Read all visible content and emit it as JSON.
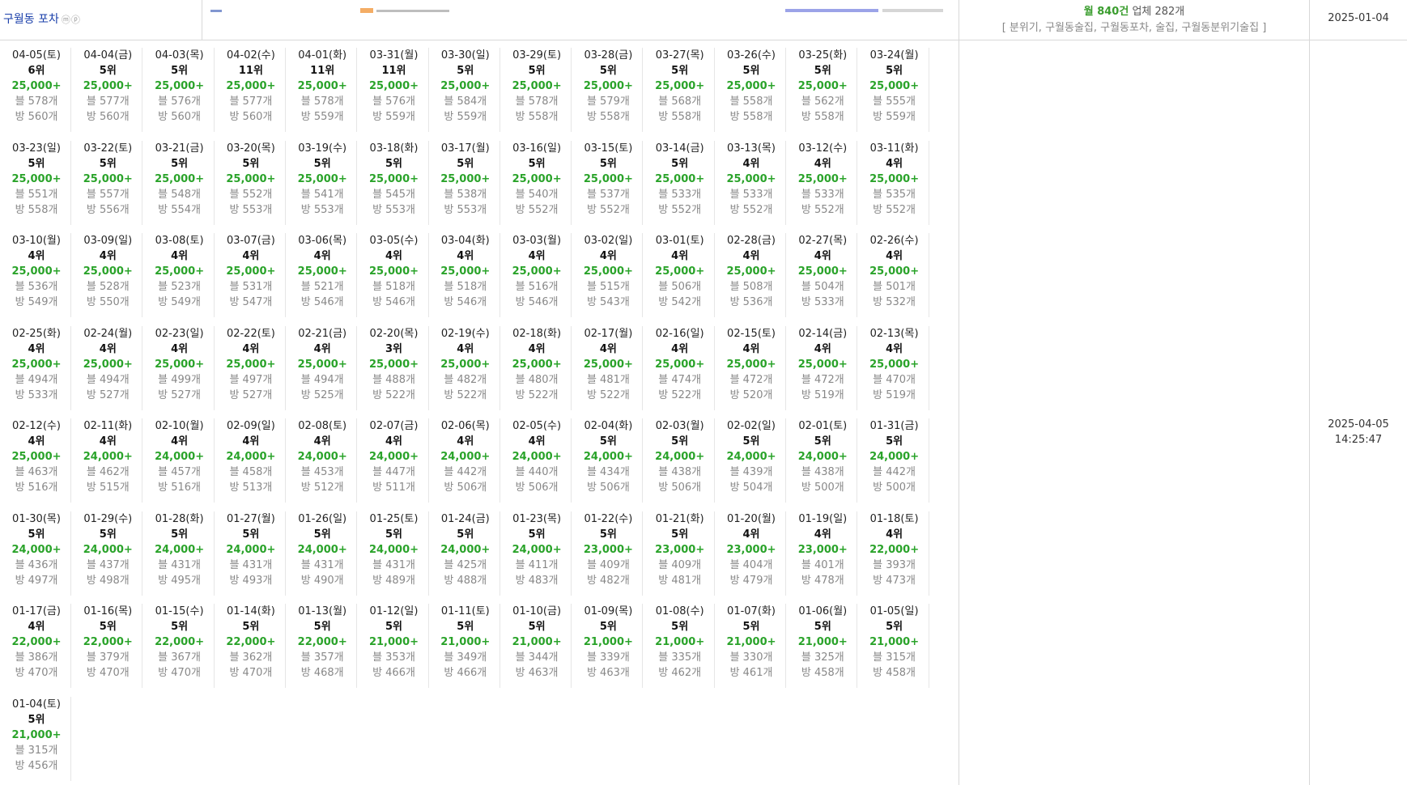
{
  "header": {
    "shop_name": "구월동 포차",
    "shop_badge": "ⓜⓟ",
    "summary_prefix": "월 ",
    "summary_count": "840건",
    "summary_suffix": " 업체 282개",
    "keywords": "[ 분위기, 구월동술집, 구월동포차, 술집, 구월동분위기술집 ]",
    "start_date": "2025-01-04"
  },
  "updated_date": "2025-04-05",
  "updated_time": "14:25:47",
  "colors": {
    "price": "#2aa32a",
    "title": "#1a3faa",
    "muted": "#888888",
    "accent": "#3a9d2e"
  },
  "entries": [
    {
      "date": "04-05(토)",
      "rank": "6위",
      "price": "25,000+",
      "blog": "블 578개",
      "bang": "방 560개"
    },
    {
      "date": "04-04(금)",
      "rank": "5위",
      "price": "25,000+",
      "blog": "블 577개",
      "bang": "방 560개"
    },
    {
      "date": "04-03(목)",
      "rank": "5위",
      "price": "25,000+",
      "blog": "블 576개",
      "bang": "방 560개"
    },
    {
      "date": "04-02(수)",
      "rank": "11위",
      "price": "25,000+",
      "blog": "블 577개",
      "bang": "방 560개"
    },
    {
      "date": "04-01(화)",
      "rank": "11위",
      "price": "25,000+",
      "blog": "블 578개",
      "bang": "방 559개"
    },
    {
      "date": "03-31(월)",
      "rank": "11위",
      "price": "25,000+",
      "blog": "블 576개",
      "bang": "방 559개"
    },
    {
      "date": "03-30(일)",
      "rank": "5위",
      "price": "25,000+",
      "blog": "블 584개",
      "bang": "방 559개"
    },
    {
      "date": "03-29(토)",
      "rank": "5위",
      "price": "25,000+",
      "blog": "블 578개",
      "bang": "방 558개"
    },
    {
      "date": "03-28(금)",
      "rank": "5위",
      "price": "25,000+",
      "blog": "블 579개",
      "bang": "방 558개"
    },
    {
      "date": "03-27(목)",
      "rank": "5위",
      "price": "25,000+",
      "blog": "블 568개",
      "bang": "방 558개"
    },
    {
      "date": "03-26(수)",
      "rank": "5위",
      "price": "25,000+",
      "blog": "블 558개",
      "bang": "방 558개"
    },
    {
      "date": "03-25(화)",
      "rank": "5위",
      "price": "25,000+",
      "blog": "블 562개",
      "bang": "방 558개"
    },
    {
      "date": "03-24(월)",
      "rank": "5위",
      "price": "25,000+",
      "blog": "블 555개",
      "bang": "방 559개"
    },
    {
      "date": "03-23(일)",
      "rank": "5위",
      "price": "25,000+",
      "blog": "블 551개",
      "bang": "방 558개"
    },
    {
      "date": "03-22(토)",
      "rank": "5위",
      "price": "25,000+",
      "blog": "블 557개",
      "bang": "방 556개"
    },
    {
      "date": "03-21(금)",
      "rank": "5위",
      "price": "25,000+",
      "blog": "블 548개",
      "bang": "방 554개"
    },
    {
      "date": "03-20(목)",
      "rank": "5위",
      "price": "25,000+",
      "blog": "블 552개",
      "bang": "방 553개"
    },
    {
      "date": "03-19(수)",
      "rank": "5위",
      "price": "25,000+",
      "blog": "블 541개",
      "bang": "방 553개"
    },
    {
      "date": "03-18(화)",
      "rank": "5위",
      "price": "25,000+",
      "blog": "블 545개",
      "bang": "방 553개"
    },
    {
      "date": "03-17(월)",
      "rank": "5위",
      "price": "25,000+",
      "blog": "블 538개",
      "bang": "방 553개"
    },
    {
      "date": "03-16(일)",
      "rank": "5위",
      "price": "25,000+",
      "blog": "블 540개",
      "bang": "방 552개"
    },
    {
      "date": "03-15(토)",
      "rank": "5위",
      "price": "25,000+",
      "blog": "블 537개",
      "bang": "방 552개"
    },
    {
      "date": "03-14(금)",
      "rank": "5위",
      "price": "25,000+",
      "blog": "블 533개",
      "bang": "방 552개"
    },
    {
      "date": "03-13(목)",
      "rank": "4위",
      "price": "25,000+",
      "blog": "블 533개",
      "bang": "방 552개"
    },
    {
      "date": "03-12(수)",
      "rank": "4위",
      "price": "25,000+",
      "blog": "블 533개",
      "bang": "방 552개"
    },
    {
      "date": "03-11(화)",
      "rank": "4위",
      "price": "25,000+",
      "blog": "블 535개",
      "bang": "방 552개"
    },
    {
      "date": "03-10(월)",
      "rank": "4위",
      "price": "25,000+",
      "blog": "블 536개",
      "bang": "방 549개"
    },
    {
      "date": "03-09(일)",
      "rank": "4위",
      "price": "25,000+",
      "blog": "블 528개",
      "bang": "방 550개"
    },
    {
      "date": "03-08(토)",
      "rank": "4위",
      "price": "25,000+",
      "blog": "블 523개",
      "bang": "방 549개"
    },
    {
      "date": "03-07(금)",
      "rank": "4위",
      "price": "25,000+",
      "blog": "블 531개",
      "bang": "방 547개"
    },
    {
      "date": "03-06(목)",
      "rank": "4위",
      "price": "25,000+",
      "blog": "블 521개",
      "bang": "방 546개"
    },
    {
      "date": "03-05(수)",
      "rank": "4위",
      "price": "25,000+",
      "blog": "블 518개",
      "bang": "방 546개"
    },
    {
      "date": "03-04(화)",
      "rank": "4위",
      "price": "25,000+",
      "blog": "블 518개",
      "bang": "방 546개"
    },
    {
      "date": "03-03(월)",
      "rank": "4위",
      "price": "25,000+",
      "blog": "블 516개",
      "bang": "방 546개"
    },
    {
      "date": "03-02(일)",
      "rank": "4위",
      "price": "25,000+",
      "blog": "블 515개",
      "bang": "방 543개"
    },
    {
      "date": "03-01(토)",
      "rank": "4위",
      "price": "25,000+",
      "blog": "블 506개",
      "bang": "방 542개"
    },
    {
      "date": "02-28(금)",
      "rank": "4위",
      "price": "25,000+",
      "blog": "블 508개",
      "bang": "방 536개"
    },
    {
      "date": "02-27(목)",
      "rank": "4위",
      "price": "25,000+",
      "blog": "블 504개",
      "bang": "방 533개"
    },
    {
      "date": "02-26(수)",
      "rank": "4위",
      "price": "25,000+",
      "blog": "블 501개",
      "bang": "방 532개"
    },
    {
      "date": "02-25(화)",
      "rank": "4위",
      "price": "25,000+",
      "blog": "블 494개",
      "bang": "방 533개"
    },
    {
      "date": "02-24(월)",
      "rank": "4위",
      "price": "25,000+",
      "blog": "블 494개",
      "bang": "방 527개"
    },
    {
      "date": "02-23(일)",
      "rank": "4위",
      "price": "25,000+",
      "blog": "블 499개",
      "bang": "방 527개"
    },
    {
      "date": "02-22(토)",
      "rank": "4위",
      "price": "25,000+",
      "blog": "블 497개",
      "bang": "방 527개"
    },
    {
      "date": "02-21(금)",
      "rank": "4위",
      "price": "25,000+",
      "blog": "블 494개",
      "bang": "방 525개"
    },
    {
      "date": "02-20(목)",
      "rank": "3위",
      "price": "25,000+",
      "blog": "블 488개",
      "bang": "방 522개"
    },
    {
      "date": "02-19(수)",
      "rank": "4위",
      "price": "25,000+",
      "blog": "블 482개",
      "bang": "방 522개"
    },
    {
      "date": "02-18(화)",
      "rank": "4위",
      "price": "25,000+",
      "blog": "블 480개",
      "bang": "방 522개"
    },
    {
      "date": "02-17(월)",
      "rank": "4위",
      "price": "25,000+",
      "blog": "블 481개",
      "bang": "방 522개"
    },
    {
      "date": "02-16(일)",
      "rank": "4위",
      "price": "25,000+",
      "blog": "블 474개",
      "bang": "방 522개"
    },
    {
      "date": "02-15(토)",
      "rank": "4위",
      "price": "25,000+",
      "blog": "블 472개",
      "bang": "방 520개"
    },
    {
      "date": "02-14(금)",
      "rank": "4위",
      "price": "25,000+",
      "blog": "블 472개",
      "bang": "방 519개"
    },
    {
      "date": "02-13(목)",
      "rank": "4위",
      "price": "25,000+",
      "blog": "블 470개",
      "bang": "방 519개"
    },
    {
      "date": "02-12(수)",
      "rank": "4위",
      "price": "25,000+",
      "blog": "블 463개",
      "bang": "방 516개"
    },
    {
      "date": "02-11(화)",
      "rank": "4위",
      "price": "24,000+",
      "blog": "블 462개",
      "bang": "방 515개"
    },
    {
      "date": "02-10(월)",
      "rank": "4위",
      "price": "24,000+",
      "blog": "블 457개",
      "bang": "방 516개"
    },
    {
      "date": "02-09(일)",
      "rank": "4위",
      "price": "24,000+",
      "blog": "블 458개",
      "bang": "방 513개"
    },
    {
      "date": "02-08(토)",
      "rank": "4위",
      "price": "24,000+",
      "blog": "블 453개",
      "bang": "방 512개"
    },
    {
      "date": "02-07(금)",
      "rank": "4위",
      "price": "24,000+",
      "blog": "블 447개",
      "bang": "방 511개"
    },
    {
      "date": "02-06(목)",
      "rank": "4위",
      "price": "24,000+",
      "blog": "블 442개",
      "bang": "방 506개"
    },
    {
      "date": "02-05(수)",
      "rank": "4위",
      "price": "24,000+",
      "blog": "블 440개",
      "bang": "방 506개"
    },
    {
      "date": "02-04(화)",
      "rank": "5위",
      "price": "24,000+",
      "blog": "블 434개",
      "bang": "방 506개"
    },
    {
      "date": "02-03(월)",
      "rank": "5위",
      "price": "24,000+",
      "blog": "블 438개",
      "bang": "방 506개"
    },
    {
      "date": "02-02(일)",
      "rank": "5위",
      "price": "24,000+",
      "blog": "블 439개",
      "bang": "방 504개"
    },
    {
      "date": "02-01(토)",
      "rank": "5위",
      "price": "24,000+",
      "blog": "블 438개",
      "bang": "방 500개"
    },
    {
      "date": "01-31(금)",
      "rank": "5위",
      "price": "24,000+",
      "blog": "블 442개",
      "bang": "방 500개"
    },
    {
      "date": "01-30(목)",
      "rank": "5위",
      "price": "24,000+",
      "blog": "블 436개",
      "bang": "방 497개"
    },
    {
      "date": "01-29(수)",
      "rank": "5위",
      "price": "24,000+",
      "blog": "블 437개",
      "bang": "방 498개"
    },
    {
      "date": "01-28(화)",
      "rank": "5위",
      "price": "24,000+",
      "blog": "블 431개",
      "bang": "방 495개"
    },
    {
      "date": "01-27(월)",
      "rank": "5위",
      "price": "24,000+",
      "blog": "블 431개",
      "bang": "방 493개"
    },
    {
      "date": "01-26(일)",
      "rank": "5위",
      "price": "24,000+",
      "blog": "블 431개",
      "bang": "방 490개"
    },
    {
      "date": "01-25(토)",
      "rank": "5위",
      "price": "24,000+",
      "blog": "블 431개",
      "bang": "방 489개"
    },
    {
      "date": "01-24(금)",
      "rank": "5위",
      "price": "24,000+",
      "blog": "블 425개",
      "bang": "방 488개"
    },
    {
      "date": "01-23(목)",
      "rank": "5위",
      "price": "24,000+",
      "blog": "블 411개",
      "bang": "방 483개"
    },
    {
      "date": "01-22(수)",
      "rank": "5위",
      "price": "23,000+",
      "blog": "블 409개",
      "bang": "방 482개"
    },
    {
      "date": "01-21(화)",
      "rank": "5위",
      "price": "23,000+",
      "blog": "블 409개",
      "bang": "방 481개"
    },
    {
      "date": "01-20(월)",
      "rank": "4위",
      "price": "23,000+",
      "blog": "블 404개",
      "bang": "방 479개"
    },
    {
      "date": "01-19(일)",
      "rank": "4위",
      "price": "23,000+",
      "blog": "블 401개",
      "bang": "방 478개"
    },
    {
      "date": "01-18(토)",
      "rank": "4위",
      "price": "22,000+",
      "blog": "블 393개",
      "bang": "방 473개"
    },
    {
      "date": "01-17(금)",
      "rank": "4위",
      "price": "22,000+",
      "blog": "블 386개",
      "bang": "방 470개"
    },
    {
      "date": "01-16(목)",
      "rank": "5위",
      "price": "22,000+",
      "blog": "블 379개",
      "bang": "방 470개"
    },
    {
      "date": "01-15(수)",
      "rank": "5위",
      "price": "22,000+",
      "blog": "블 367개",
      "bang": "방 470개"
    },
    {
      "date": "01-14(화)",
      "rank": "5위",
      "price": "22,000+",
      "blog": "블 362개",
      "bang": "방 470개"
    },
    {
      "date": "01-13(월)",
      "rank": "5위",
      "price": "22,000+",
      "blog": "블 357개",
      "bang": "방 468개"
    },
    {
      "date": "01-12(일)",
      "rank": "5위",
      "price": "21,000+",
      "blog": "블 353개",
      "bang": "방 466개"
    },
    {
      "date": "01-11(토)",
      "rank": "5위",
      "price": "21,000+",
      "blog": "블 349개",
      "bang": "방 466개"
    },
    {
      "date": "01-10(금)",
      "rank": "5위",
      "price": "21,000+",
      "blog": "블 344개",
      "bang": "방 463개"
    },
    {
      "date": "01-09(목)",
      "rank": "5위",
      "price": "21,000+",
      "blog": "블 339개",
      "bang": "방 463개"
    },
    {
      "date": "01-08(수)",
      "rank": "5위",
      "price": "21,000+",
      "blog": "블 335개",
      "bang": "방 462개"
    },
    {
      "date": "01-07(화)",
      "rank": "5위",
      "price": "21,000+",
      "blog": "블 330개",
      "bang": "방 461개"
    },
    {
      "date": "01-06(월)",
      "rank": "5위",
      "price": "21,000+",
      "blog": "블 325개",
      "bang": "방 458개"
    },
    {
      "date": "01-05(일)",
      "rank": "5위",
      "price": "21,000+",
      "blog": "블 315개",
      "bang": "방 458개"
    },
    {
      "date": "01-04(토)",
      "rank": "5위",
      "price": "21,000+",
      "blog": "블 315개",
      "bang": "방 456개"
    }
  ]
}
